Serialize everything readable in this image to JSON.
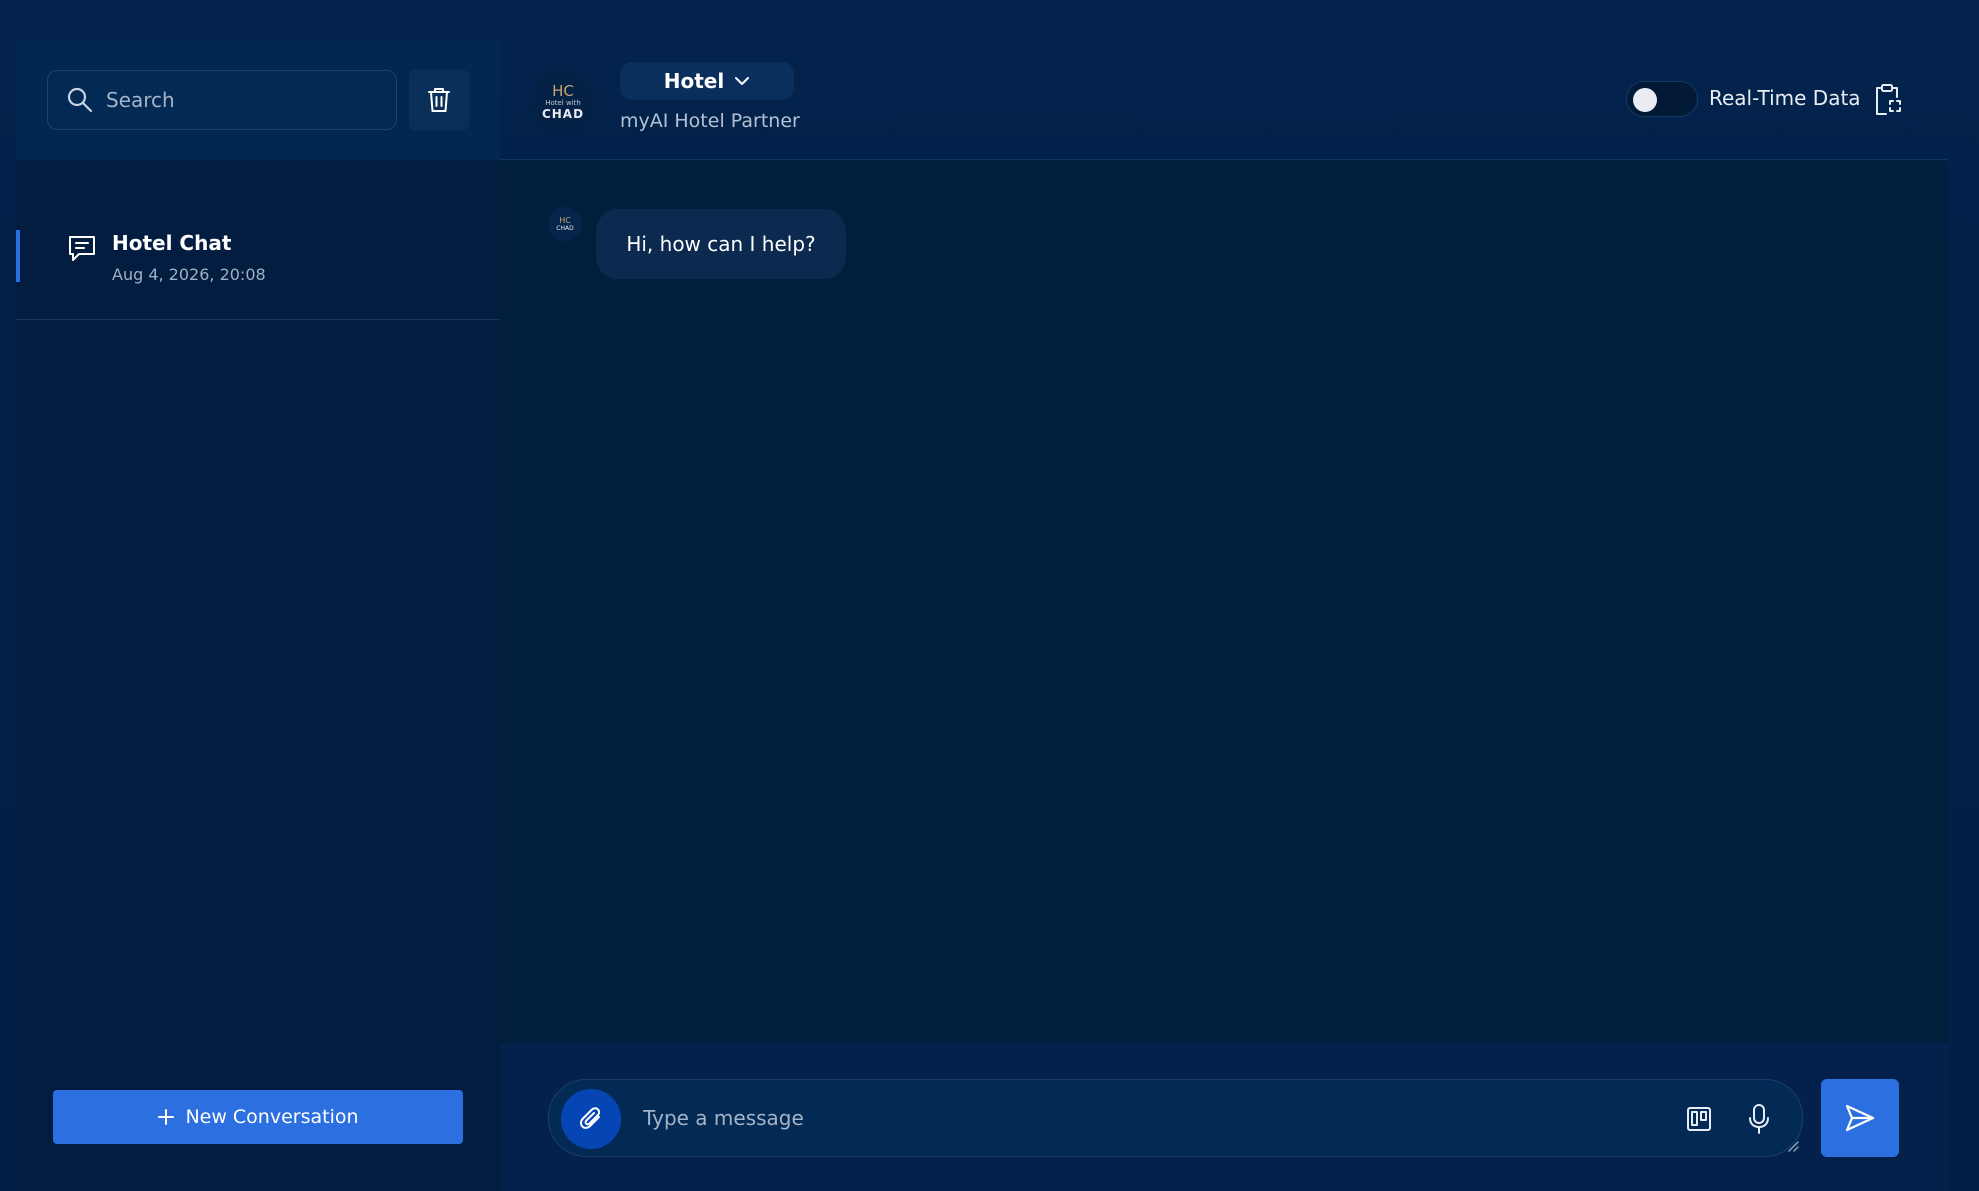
{
  "sidebar": {
    "search": {
      "placeholder": "Search",
      "value": ""
    },
    "conversations": [
      {
        "title": "Hotel Chat",
        "date": "Aug 4, 2026, 20:08"
      }
    ],
    "new_conversation_label": "New Conversation"
  },
  "header": {
    "avatar": {
      "logo_mark": "HC",
      "logo_sub": "Hotel with",
      "logo_main": "CHAD"
    },
    "model_selector": "Hotel",
    "subtitle": "myAI Hotel Partner",
    "realtime_toggle": {
      "label": "Real-Time Data",
      "enabled": false
    }
  },
  "chat": {
    "messages": [
      {
        "role": "assistant",
        "text": "Hi, how can I help?"
      }
    ]
  },
  "composer": {
    "placeholder": "Type a message",
    "value": ""
  },
  "colors": {
    "background": "#03214a",
    "sidebar": "#021d3f",
    "accent": "#2c6fe0",
    "attach": "#0645b4"
  },
  "icons": {
    "search": "search-icon",
    "trash": "trash-icon",
    "conversation": "chat-bubble-icon",
    "plus": "plus-icon",
    "chevron": "chevron-down-icon",
    "clipboard": "clipboard-icon",
    "attach": "paperclip-icon",
    "kanban": "kanban-icon",
    "mic": "microphone-icon",
    "send": "send-icon"
  }
}
